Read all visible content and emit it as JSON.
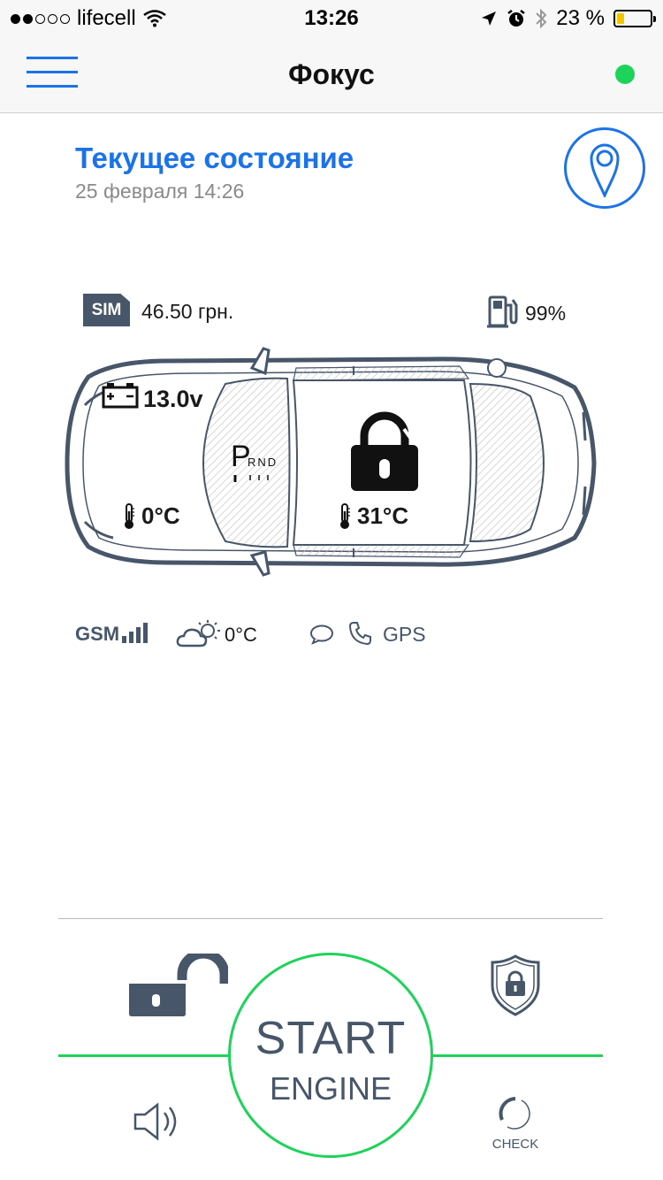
{
  "status_bar": {
    "carrier": "lifecell",
    "time": "13:26",
    "battery_percent": "23 %",
    "battery_level": 0.23
  },
  "nav": {
    "title": "Фокус",
    "online_color": "#1ed35a"
  },
  "header": {
    "title": "Текущее состояние",
    "date": "25 февраля 14:26"
  },
  "info": {
    "sim_label": "SIM",
    "balance": "46.50 грн.",
    "fuel": "99%"
  },
  "car": {
    "voltage": "13.0v",
    "gear": {
      "current": "P",
      "others": "RND"
    },
    "lock_state": "locked",
    "engine_temp": "0°C",
    "cabin_temp": "31°C"
  },
  "status_row": {
    "gsm_label": "GSM",
    "gsm_bars": 4,
    "outside_temp": "0°C",
    "gps_label": "GPS"
  },
  "controls": {
    "start_main": "START",
    "start_sub": "ENGINE",
    "check_label": "CHECK"
  },
  "colors": {
    "accent": "#1a73e8",
    "start_ring": "#1ed35a",
    "icon_gray": "#48566a"
  }
}
